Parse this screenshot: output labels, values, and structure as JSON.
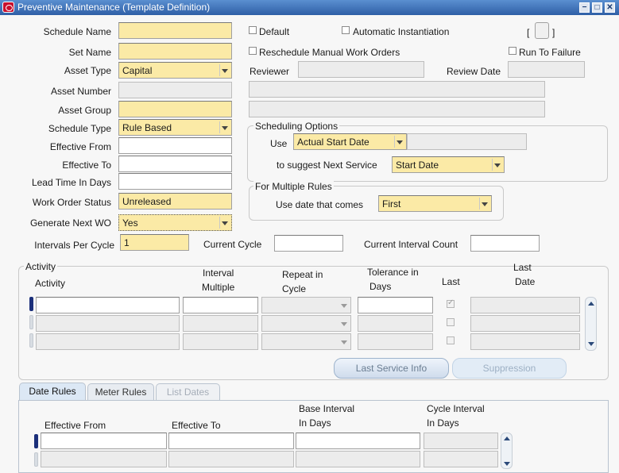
{
  "window": {
    "title": "Preventive Maintenance (Template Definition)",
    "minimize": "−",
    "maximize": "□",
    "close": "✕"
  },
  "form": {
    "schedule_name": {
      "label": "Schedule Name",
      "value": ""
    },
    "set_name": {
      "label": "Set Name",
      "value": ""
    },
    "asset_type": {
      "label": "Asset Type",
      "value": "Capital"
    },
    "asset_number": {
      "label": "Asset Number",
      "value": "",
      "desc": ""
    },
    "asset_group": {
      "label": "Asset Group",
      "value": "",
      "desc": ""
    },
    "schedule_type": {
      "label": "Schedule Type",
      "value": "Rule Based"
    },
    "effective_from": {
      "label": "Effective From",
      "value": ""
    },
    "effective_to": {
      "label": "Effective To",
      "value": ""
    },
    "lead_time": {
      "label": "Lead Time In Days",
      "value": ""
    },
    "work_order_status": {
      "label": "Work Order Status",
      "value": "Unreleased"
    },
    "generate_next_wo": {
      "label": "Generate Next WO",
      "value": "Yes"
    },
    "intervals_per_cycle": {
      "label": "Intervals Per Cycle",
      "value": "1"
    },
    "current_cycle": {
      "label": "Current Cycle",
      "value": ""
    },
    "current_interval_count": {
      "label": "Current Interval Count",
      "value": ""
    },
    "default_label": "Default",
    "auto_instantiation_label": "Automatic Instantiation",
    "reschedule_label": "Reschedule Manual Work Orders",
    "run_to_failure_label": "Run To Failure",
    "reviewer_label": "Reviewer",
    "review_date_label": "Review Date",
    "bracket_open": "[",
    "bracket_close": "]"
  },
  "scheduling_options": {
    "title": "Scheduling Options",
    "use_label": "Use",
    "use_value": "Actual Start Date",
    "suggest_label": "to suggest Next Service",
    "suggest_value": "Start Date"
  },
  "multiple_rules": {
    "title": "For Multiple Rules",
    "use_date_label": "Use date that comes",
    "use_date_value": "First"
  },
  "activity": {
    "title": "Activity",
    "headers": {
      "activity": "Activity",
      "interval_multiple_1": "Interval",
      "interval_multiple_2": "Multiple",
      "repeat_1": "Repeat in",
      "repeat_2": "Cycle",
      "tolerance_1": "Tolerance in",
      "tolerance_2": "Days",
      "last": "Last",
      "last_date_1": "Last",
      "last_date_2": "Date"
    },
    "buttons": {
      "last_service_info": "Last Service Info",
      "suppression": "Suppression"
    }
  },
  "tabs": [
    {
      "label": "Date Rules"
    },
    {
      "label": "Meter Rules"
    },
    {
      "label": "List Dates"
    }
  ],
  "date_rules": {
    "headers": {
      "effective_from": "Effective From",
      "effective_to": "Effective To",
      "base_interval_1": "Base Interval",
      "base_interval_2": "In Days",
      "cycle_interval_1": "Cycle Interval",
      "cycle_interval_2": "In Days"
    }
  }
}
